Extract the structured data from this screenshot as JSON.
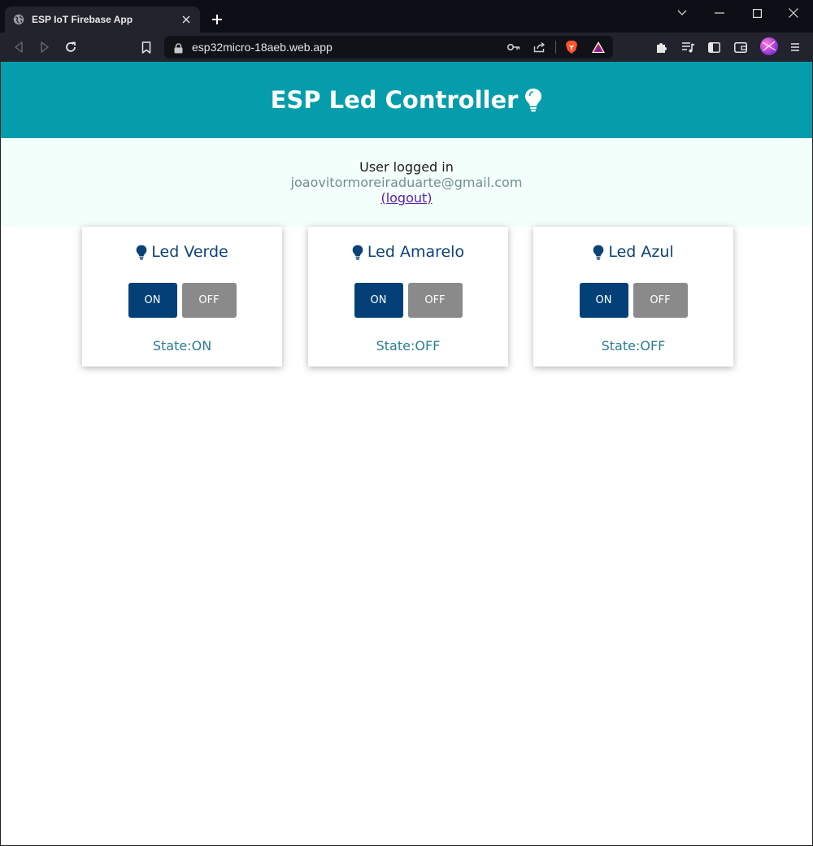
{
  "browser": {
    "tab_title": "ESP IoT Firebase App",
    "url": "esp32micro-18aeb.web.app"
  },
  "header": {
    "title": "ESP Led Controller"
  },
  "auth": {
    "status": "User logged in",
    "email": "joaovitormoreiraduarte@gmail.com",
    "logout": "(logout)"
  },
  "leds": [
    {
      "name": "Led Verde",
      "on_label": "ON",
      "off_label": "OFF",
      "state_label": "State:",
      "state": "ON"
    },
    {
      "name": "Led Amarelo",
      "on_label": "ON",
      "off_label": "OFF",
      "state_label": "State:",
      "state": "OFF"
    },
    {
      "name": "Led Azul",
      "on_label": "ON",
      "off_label": "OFF",
      "state_label": "State:",
      "state": "OFF"
    }
  ],
  "colors": {
    "header_bg": "#059dab",
    "auth_bg": "#f3fffa",
    "primary": "#034078",
    "off_button": "#8a8a8a",
    "state_text": "#2b7c90"
  }
}
